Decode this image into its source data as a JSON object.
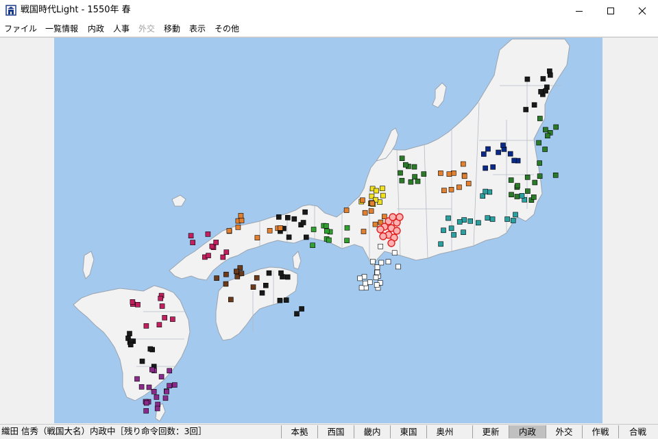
{
  "window": {
    "title": "戦国時代Light - 1550年 春",
    "controls": [
      "minimize",
      "maximize",
      "close"
    ]
  },
  "menu": [
    {
      "label": "ファイル",
      "enabled": true
    },
    {
      "label": "一覧情報",
      "enabled": true
    },
    {
      "label": "内政",
      "enabled": true
    },
    {
      "label": "人事",
      "enabled": true
    },
    {
      "label": "外交",
      "enabled": false
    },
    {
      "label": "移動",
      "enabled": true
    },
    {
      "label": "表示",
      "enabled": true
    },
    {
      "label": "その他",
      "enabled": true
    }
  ],
  "map": {
    "sea_color": "#a3c9ee",
    "land_color": "#f2f2f2",
    "player_clan_color": "#e02020"
  },
  "status": {
    "text": "織田 信秀（戦国大名）内政中［残り命令回数：3回］"
  },
  "region_buttons": [
    {
      "label": "本拠"
    },
    {
      "label": "西国"
    },
    {
      "label": "畿内"
    },
    {
      "label": "東国"
    },
    {
      "label": "奥州"
    }
  ],
  "mode_buttons": [
    {
      "label": "更新",
      "active": false
    },
    {
      "label": "内政",
      "active": true
    },
    {
      "label": "外交",
      "active": false
    },
    {
      "label": "作戦",
      "active": false
    },
    {
      "label": "合戦",
      "active": false
    }
  ]
}
